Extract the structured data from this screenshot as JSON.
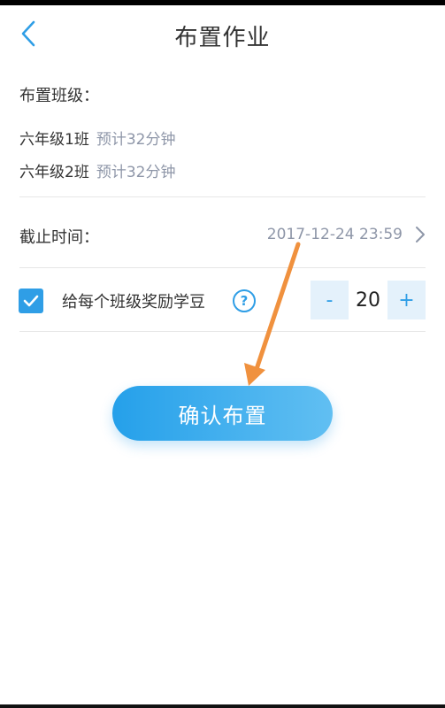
{
  "header": {
    "title": "布置作业"
  },
  "classes_section": {
    "label": "布置班级：",
    "items": [
      {
        "name": "六年级1班",
        "estimate": "预计32分钟"
      },
      {
        "name": "六年级2班",
        "estimate": "预计32分钟"
      }
    ]
  },
  "deadline": {
    "label": "截止时间：",
    "value": "2017-12-24 23:59"
  },
  "reward": {
    "checked": true,
    "label": "给每个班级奖励学豆",
    "help": "?",
    "minus": "-",
    "value": "20",
    "plus": "+"
  },
  "actions": {
    "confirm_label": "确认布置"
  },
  "colors": {
    "accent": "#2f9ee6",
    "muted_text": "#8e96a8",
    "annotation_arrow": "#f0913e"
  }
}
